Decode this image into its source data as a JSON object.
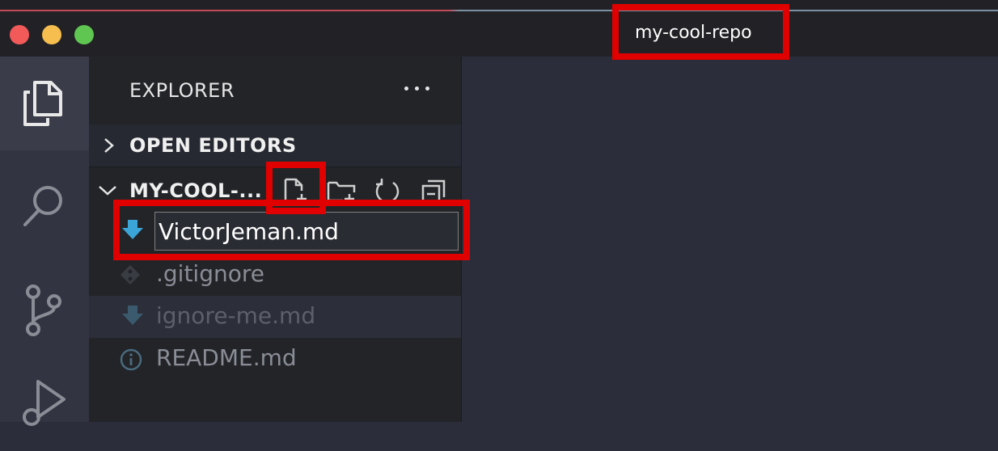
{
  "window": {
    "title": "my-cool-repo"
  },
  "colors": {
    "highlight": "#e00000",
    "accent": "#3ba5d8"
  },
  "activity_bar": {
    "items": [
      {
        "icon": "files-icon",
        "active": true
      },
      {
        "icon": "search-icon",
        "active": false
      },
      {
        "icon": "source-control-icon",
        "active": false
      },
      {
        "icon": "run-debug-icon",
        "active": false
      }
    ]
  },
  "sidebar": {
    "title": "EXPLORER",
    "open_editors_label": "OPEN EDITORS",
    "repo_label": "MY-COOL-...",
    "toolbar": {
      "new_file_icon": "new-file-icon",
      "new_folder_icon": "new-folder-icon",
      "refresh_icon": "refresh-icon",
      "collapse_icon": "collapse-all-icon"
    },
    "rename_value": "VictorJeman.md",
    "files": [
      {
        "name": ".gitignore",
        "icon": "git-icon"
      },
      {
        "name": "ignore-me.md",
        "icon": "markdown-icon"
      },
      {
        "name": "README.md",
        "icon": "info-icon"
      }
    ]
  }
}
